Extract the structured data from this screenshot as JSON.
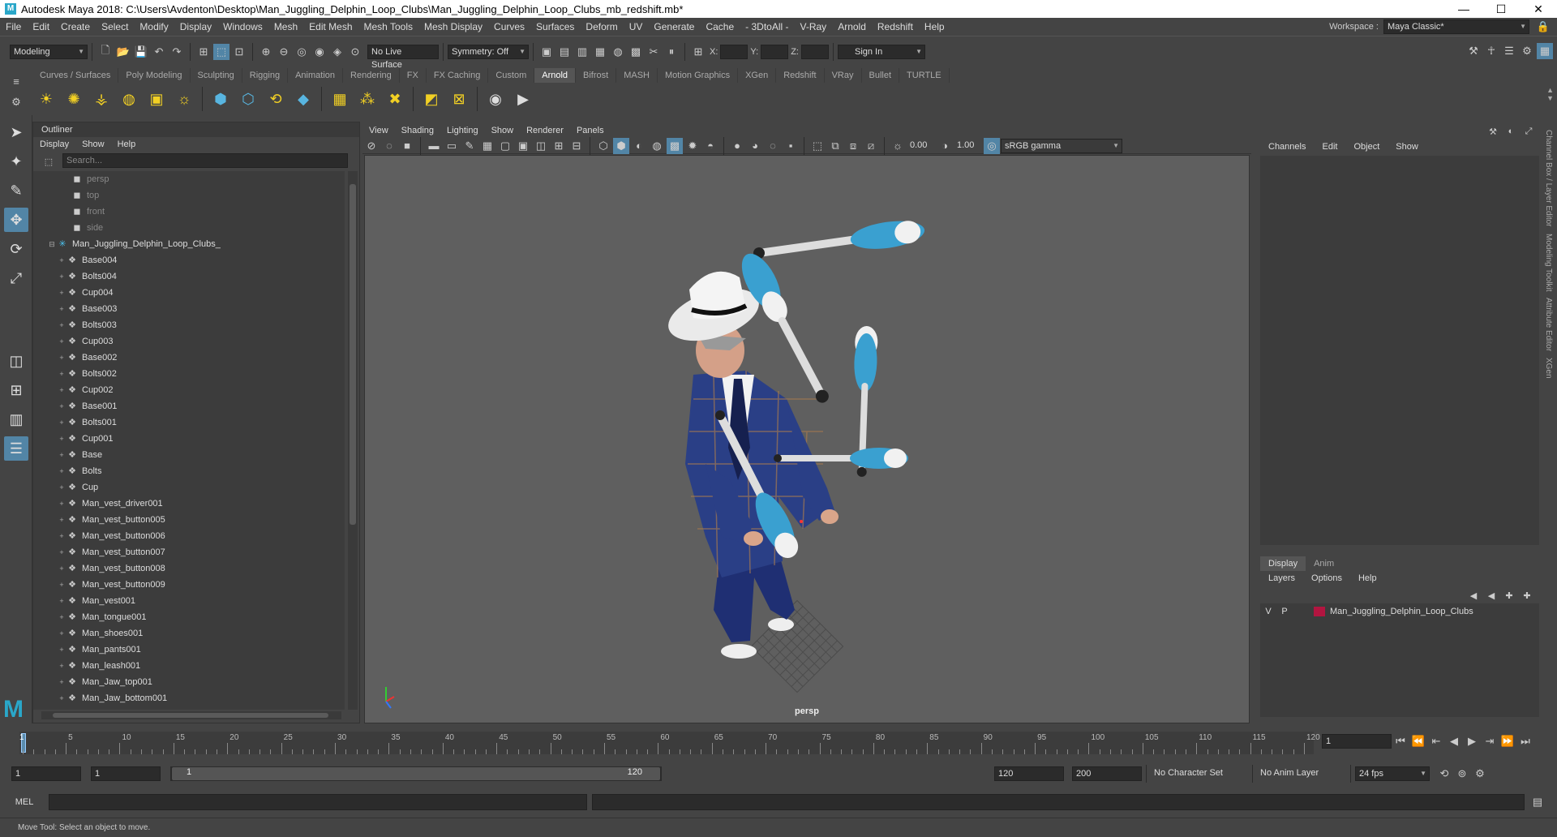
{
  "window": {
    "title": "Autodesk Maya 2018: C:\\Users\\Avdenton\\Desktop\\Man_Juggling_Delphin_Loop_Clubs\\Man_Juggling_Delphin_Loop_Clubs_mb_redshift.mb*"
  },
  "menubar": {
    "items": [
      "File",
      "Edit",
      "Create",
      "Select",
      "Modify",
      "Display",
      "Windows",
      "Mesh",
      "Edit Mesh",
      "Mesh Tools",
      "Mesh Display",
      "Curves",
      "Surfaces",
      "Deform",
      "UV",
      "Generate",
      "Cache",
      "- 3DtoAll -",
      "V-Ray",
      "Arnold",
      "Redshift",
      "Help"
    ],
    "workspace_label": "Workspace :",
    "workspace_value": "Maya Classic*"
  },
  "statusline": {
    "mode": "Modeling",
    "live_surface": "No Live Surface",
    "symmetry": "Symmetry: Off",
    "x_label": "X:",
    "y_label": "Y:",
    "z_label": "Z:",
    "sign_in": "Sign In"
  },
  "shelf": {
    "tabs": [
      "Curves / Surfaces",
      "Poly Modeling",
      "Sculpting",
      "Rigging",
      "Animation",
      "Rendering",
      "FX",
      "FX Caching",
      "Custom",
      "Arnold",
      "Bifrost",
      "MASH",
      "Motion Graphics",
      "XGen",
      "Redshift",
      "VRay",
      "Bullet",
      "TURTLE"
    ],
    "active_tab": "Arnold"
  },
  "outliner": {
    "title": "Outliner",
    "menu": [
      "Display",
      "Show",
      "Help"
    ],
    "search_placeholder": "Search...",
    "items": [
      {
        "label": "persp",
        "type": "camera"
      },
      {
        "label": "top",
        "type": "camera"
      },
      {
        "label": "front",
        "type": "camera"
      },
      {
        "label": "side",
        "type": "camera"
      },
      {
        "label": "Man_Juggling_Delphin_Loop_Clubs_",
        "type": "root"
      },
      {
        "label": "Base004",
        "type": "mesh"
      },
      {
        "label": "Bolts004",
        "type": "mesh"
      },
      {
        "label": "Cup004",
        "type": "mesh"
      },
      {
        "label": "Base003",
        "type": "mesh"
      },
      {
        "label": "Bolts003",
        "type": "mesh"
      },
      {
        "label": "Cup003",
        "type": "mesh"
      },
      {
        "label": "Base002",
        "type": "mesh"
      },
      {
        "label": "Bolts002",
        "type": "mesh"
      },
      {
        "label": "Cup002",
        "type": "mesh"
      },
      {
        "label": "Base001",
        "type": "mesh"
      },
      {
        "label": "Bolts001",
        "type": "mesh"
      },
      {
        "label": "Cup001",
        "type": "mesh"
      },
      {
        "label": "Base",
        "type": "mesh"
      },
      {
        "label": "Bolts",
        "type": "mesh"
      },
      {
        "label": "Cup",
        "type": "mesh"
      },
      {
        "label": "Man_vest_driver001",
        "type": "mesh"
      },
      {
        "label": "Man_vest_button005",
        "type": "mesh"
      },
      {
        "label": "Man_vest_button006",
        "type": "mesh"
      },
      {
        "label": "Man_vest_button007",
        "type": "mesh"
      },
      {
        "label": "Man_vest_button008",
        "type": "mesh"
      },
      {
        "label": "Man_vest_button009",
        "type": "mesh"
      },
      {
        "label": "Man_vest001",
        "type": "mesh"
      },
      {
        "label": "Man_tongue001",
        "type": "mesh"
      },
      {
        "label": "Man_shoes001",
        "type": "mesh"
      },
      {
        "label": "Man_pants001",
        "type": "mesh"
      },
      {
        "label": "Man_leash001",
        "type": "mesh"
      },
      {
        "label": "Man_Jaw_top001",
        "type": "mesh"
      },
      {
        "label": "Man_Jaw_bottom001",
        "type": "mesh"
      }
    ]
  },
  "viewport": {
    "menu": [
      "View",
      "Shading",
      "Lighting",
      "Show",
      "Renderer",
      "Panels"
    ],
    "exposure": "0.00",
    "gamma": "1.00",
    "color_space": "sRGB gamma",
    "camera_label": "persp"
  },
  "channelbox": {
    "menu": [
      "Channels",
      "Edit",
      "Object",
      "Show"
    ],
    "side_tabs": [
      "Channel Box / Layer Editor",
      "Modeling Toolkit",
      "Attribute Editor",
      "XGen"
    ]
  },
  "layers": {
    "tabs": [
      "Display",
      "Anim"
    ],
    "active_tab": "Display",
    "menu": [
      "Layers",
      "Options",
      "Help"
    ],
    "rows": [
      {
        "v": "V",
        "p": "P",
        "name": "Man_Juggling_Delphin_Loop_Clubs",
        "color": "#b21540"
      }
    ]
  },
  "timeline": {
    "ticks": [
      "5",
      "10",
      "15",
      "20",
      "25",
      "30",
      "35",
      "40",
      "45",
      "50",
      "55",
      "60",
      "65",
      "70",
      "75",
      "80",
      "85",
      "90",
      "95",
      "100",
      "105",
      "110",
      "115",
      "120"
    ],
    "start": 1,
    "end": 120,
    "current_frame": "1",
    "playhead_label": "1"
  },
  "range": {
    "start_field": "1",
    "anim_start": "1",
    "range_start_label": "1",
    "range_end_label": "120",
    "range_end": "120",
    "anim_end": "200",
    "character_set": "No Character Set",
    "anim_layer": "No Anim Layer",
    "fps": "24 fps"
  },
  "cmdline": {
    "label": "MEL"
  },
  "helpline": {
    "text": "Move Tool: Select an object to move."
  },
  "colors": {
    "accent": "#5285a6",
    "layer": "#b21540",
    "club_blue": "#3aa0d0",
    "suit": "#2a3f86"
  }
}
